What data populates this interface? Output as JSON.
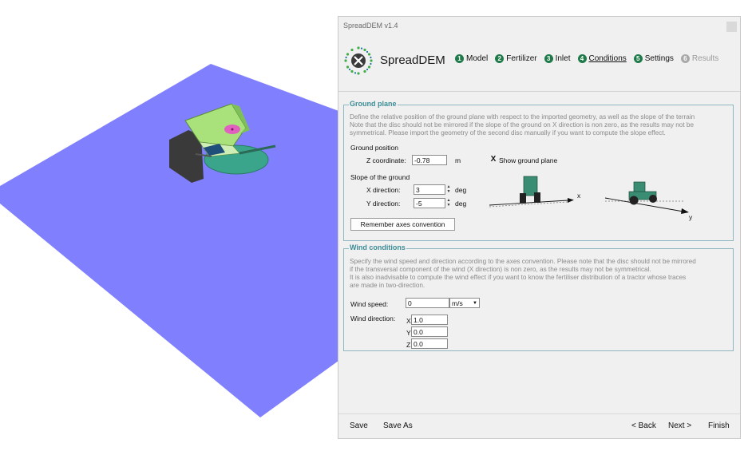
{
  "app": {
    "window_title": "SpreadDEM v1.4",
    "brand": "SpreadDEM"
  },
  "steps": [
    {
      "num": "1",
      "label": "Model",
      "state": "done"
    },
    {
      "num": "2",
      "label": "Fertilizer",
      "state": "done"
    },
    {
      "num": "3",
      "label": "Inlet",
      "state": "done"
    },
    {
      "num": "4",
      "label": "Conditions",
      "state": "active"
    },
    {
      "num": "5",
      "label": "Settings",
      "state": "done"
    },
    {
      "num": "6",
      "label": "Results",
      "state": "disabled"
    }
  ],
  "ground": {
    "legend": "Ground plane",
    "desc1": "Define the relative position of the ground plane with respect to the imported geometry, as well as the slope of the terrain",
    "desc2": "Note that the disc should not be mirrored if the slope of the ground on X direction is non zero, as the results may not be",
    "desc3": "symmetrical. Please import the geometry of the second disc manually if you want to compute the slope effect.",
    "position_heading": "Ground position",
    "z_label": "Z coordinate:",
    "z_value": "-0.78",
    "z_unit": "m",
    "show_plane_label": "Show ground plane",
    "show_plane_checked": "X",
    "slope_heading": "Slope of the ground",
    "x_dir_label": "X direction:",
    "x_dir_value": "3",
    "y_dir_label": "Y direction:",
    "y_dir_value": "-5",
    "deg": "deg",
    "axis_x": "x",
    "axis_y": "y",
    "remember_btn": "Remember axes convention"
  },
  "wind": {
    "legend": "Wind conditions",
    "desc1": "Specify the wind speed and direction according to the axes convention. Please note that the disc should not be mirrored",
    "desc2": "if the transversal component of the wind (X direction) is non zero, as the results may not be symmetrical.",
    "desc3": "It is also inadvisable to compute the wind effect if you want to know the fertiliser distribution of a tractor whose traces",
    "desc4": "are made in two-direction.",
    "speed_label": "Wind speed:",
    "speed_value": "0",
    "speed_unit": "m/s",
    "dir_label": "Wind direction:",
    "x_label": "X",
    "x_value": "1.0",
    "y_label": "Y",
    "y_value": "0.0",
    "z_label": "Z",
    "z_value": "0.0"
  },
  "footer": {
    "save": "Save",
    "save_as": "Save As",
    "back": "< Back",
    "next": "Next >",
    "finish": "Finish"
  },
  "colors": {
    "ground_plane": "#8080ff",
    "accent_green": "#1f7a4a",
    "legend_teal": "#3c8c96",
    "tractor": "#3a8c72"
  }
}
